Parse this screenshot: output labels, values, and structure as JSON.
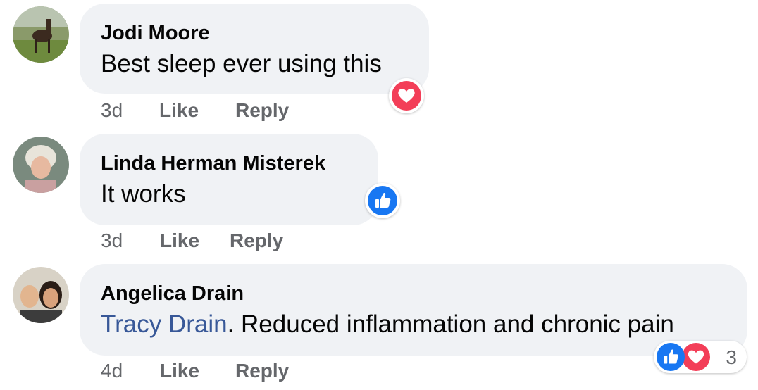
{
  "comments": [
    {
      "author": "Jodi Moore",
      "text": "Best sleep ever using this",
      "time": "3d",
      "like_label": "Like",
      "reply_label": "Reply",
      "reaction": "heart-icon"
    },
    {
      "author": "Linda Herman Misterek",
      "text": "It works",
      "time": "3d",
      "like_label": "Like",
      "reply_label": "Reply",
      "reaction": "thumbs-up-icon"
    },
    {
      "author": "Angelica Drain",
      "mention": "Tracy Drain",
      "text": ". Reduced inflammation and chronic pain",
      "time": "4d",
      "like_label": "Like",
      "reply_label": "Reply",
      "reactions": [
        "thumbs-up-icon",
        "heart-icon"
      ],
      "reaction_count": "3"
    }
  ],
  "colors": {
    "bubble": "#f0f2f5",
    "text": "#050505",
    "meta": "#65676b",
    "mention": "#385898",
    "like_blue": "#1877f2",
    "heart_red": "#f33e58"
  }
}
